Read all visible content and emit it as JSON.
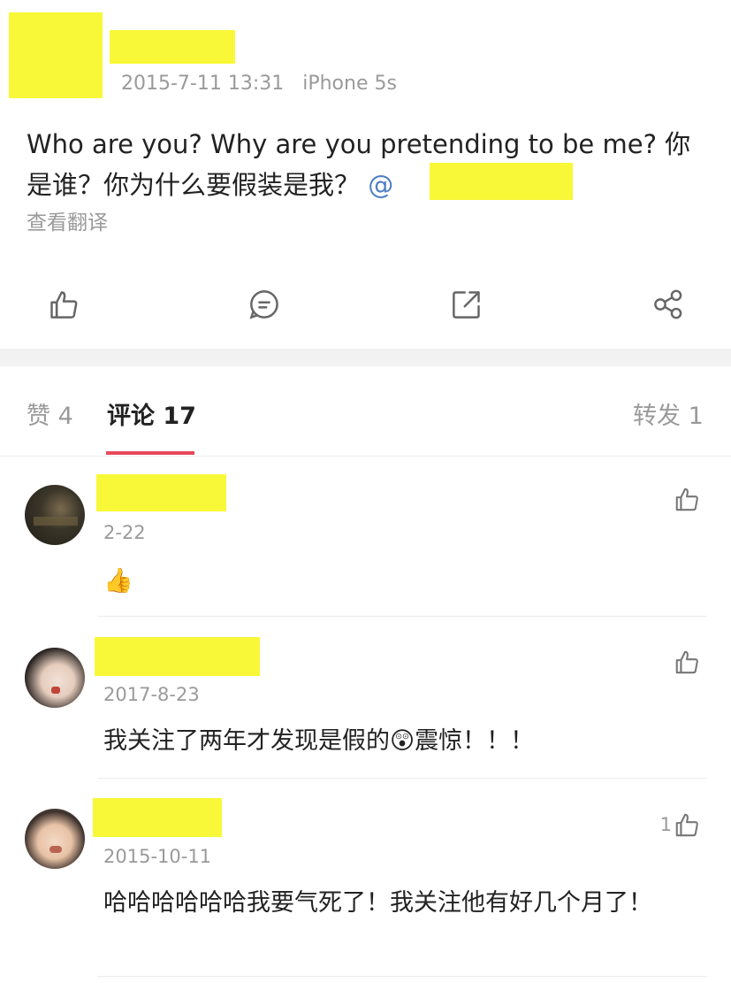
{
  "post": {
    "meta": "2015-7-11 13:31   iPhone 5s",
    "text": "Who are you? Why are you pretending to be me?  你是谁？你为什么要假装是我？",
    "mention_at": "@",
    "translate_label": "查看翻译"
  },
  "actions": [
    {
      "icon": "thumbs-up-icon"
    },
    {
      "icon": "comment-icon"
    },
    {
      "icon": "repost-icon"
    },
    {
      "icon": "share-icon"
    }
  ],
  "tabs": {
    "likes": "赞 4",
    "comments": "评论 17",
    "reposts": "转发 1"
  },
  "comments": [
    {
      "date": "2-22",
      "text": "👍",
      "like_count": ""
    },
    {
      "date": "2017-8-23",
      "text": "我关注了两年才发现是假的😲震惊！！！",
      "like_count": ""
    },
    {
      "date": "2015-10-11",
      "text": "哈哈哈哈哈哈我要气死了！我关注他有好几个月了！",
      "like_count": "1"
    }
  ],
  "colors": {
    "accent": "#e8495a",
    "mention": "#4e7ec5",
    "redaction": "#f8f838"
  }
}
